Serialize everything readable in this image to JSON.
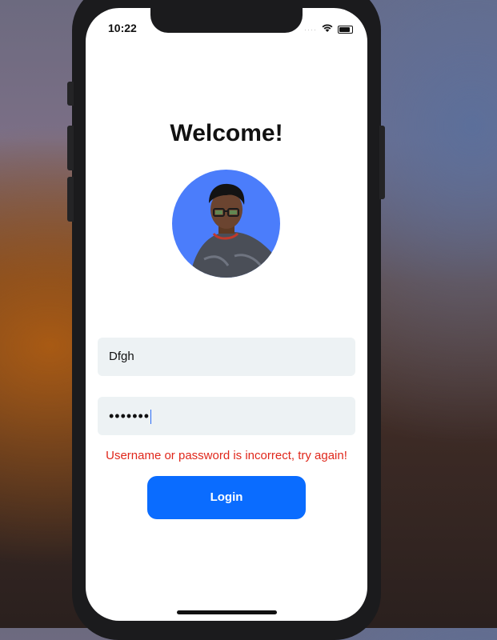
{
  "status_bar": {
    "time": "10:22",
    "signal": "····",
    "wifi_icon": "wifi-icon",
    "battery_icon": "battery-icon"
  },
  "login": {
    "title": "Welcome!",
    "avatar_icon": "profile-photo",
    "username_value": "Dfgh",
    "password_value": "•••••••",
    "error_message": "Username or password is incorrect, try again!",
    "login_label": "Login"
  },
  "colors": {
    "accent": "#0A6CFF",
    "error": "#E0271B",
    "avatar_bg": "#4B7DFB",
    "field_bg": "#EDF2F4"
  }
}
